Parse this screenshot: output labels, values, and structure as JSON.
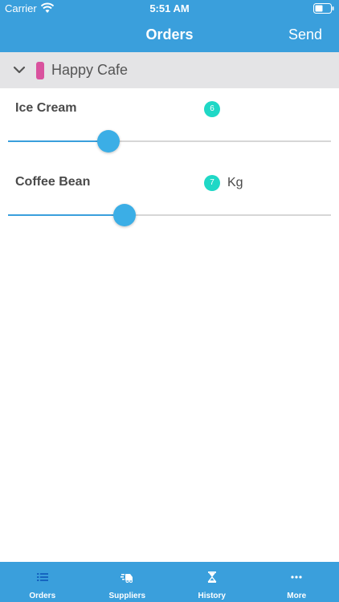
{
  "status_bar": {
    "carrier": "Carrier",
    "time": "5:51 AM"
  },
  "nav": {
    "title": "Orders",
    "send_label": "Send"
  },
  "section": {
    "name": "Happy Cafe",
    "tag_color": "#d9529e"
  },
  "items": [
    {
      "name": "Ice Cream",
      "quantity": "6",
      "unit": "",
      "slider_fraction": 0.31
    },
    {
      "name": "Coffee Bean",
      "quantity": "7",
      "unit": "Kg",
      "slider_fraction": 0.36
    }
  ],
  "tabs": [
    {
      "label": "Orders",
      "icon": "list-icon"
    },
    {
      "label": "Suppliers",
      "icon": "delivery-truck-icon"
    },
    {
      "label": "History",
      "icon": "hourglass-icon"
    },
    {
      "label": "More",
      "icon": "more-dots-icon"
    }
  ],
  "colors": {
    "primary": "#3a9fdc",
    "badge": "#1fd8c6",
    "thumb": "#3baee6"
  }
}
